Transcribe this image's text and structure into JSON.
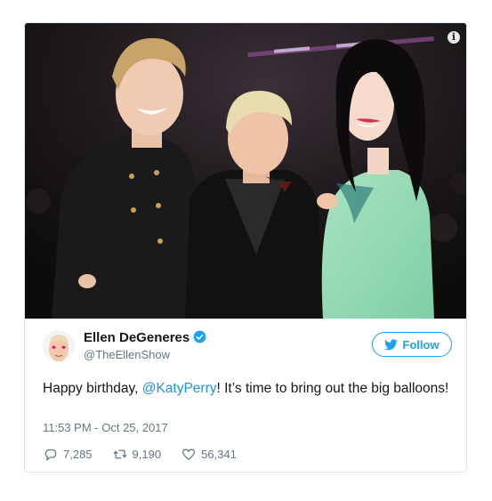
{
  "tweet": {
    "display_name": "Ellen DeGeneres",
    "handle": "@TheEllenShow",
    "follow_label": "Follow",
    "text_before": "Happy birthday, ",
    "mention": "@KatyPerry",
    "text_after": "! It’s time to bring out the big balloons!",
    "timestamp": "11:53 PM - Oct 25, 2017",
    "replies": "7,285",
    "retweets": "9,190",
    "likes": "56,341"
  },
  "icons": {
    "info": "info-icon",
    "verified": "verified-badge-icon",
    "follow": "twitter-bird-icon",
    "reply": "reply-icon",
    "retweet": "retweet-icon",
    "like": "heart-icon"
  },
  "colors": {
    "accent": "#1da1f2",
    "link": "#1b95e0",
    "secondary_text": "#657786",
    "primary_text": "#14171a",
    "border": "#e1e8ed"
  },
  "info_glyph": "i"
}
